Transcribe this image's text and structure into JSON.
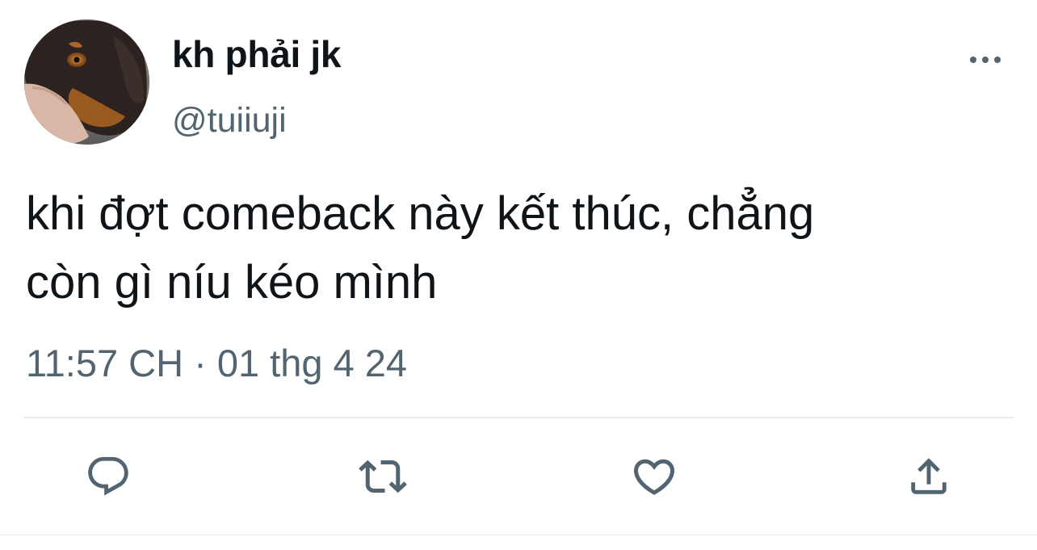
{
  "author": {
    "display_name": "kh phải jk",
    "handle": "@tuiiuji",
    "avatar": "doberman-dog-photo"
  },
  "tweet": {
    "text": "khi đợt comeback này kết thúc, chẳng\ncòn gì níu kéo mình",
    "timestamp": "11:57 CH · 01 thg 4 24"
  },
  "icons": {
    "more": "more-dots-icon",
    "reply": "reply-icon",
    "retweet": "retweet-icon",
    "like": "heart-icon",
    "share": "share-icon"
  },
  "colors": {
    "text_primary": "#0f1419",
    "text_secondary": "#536471",
    "icon": "#536471",
    "divider": "#e8ecee"
  }
}
